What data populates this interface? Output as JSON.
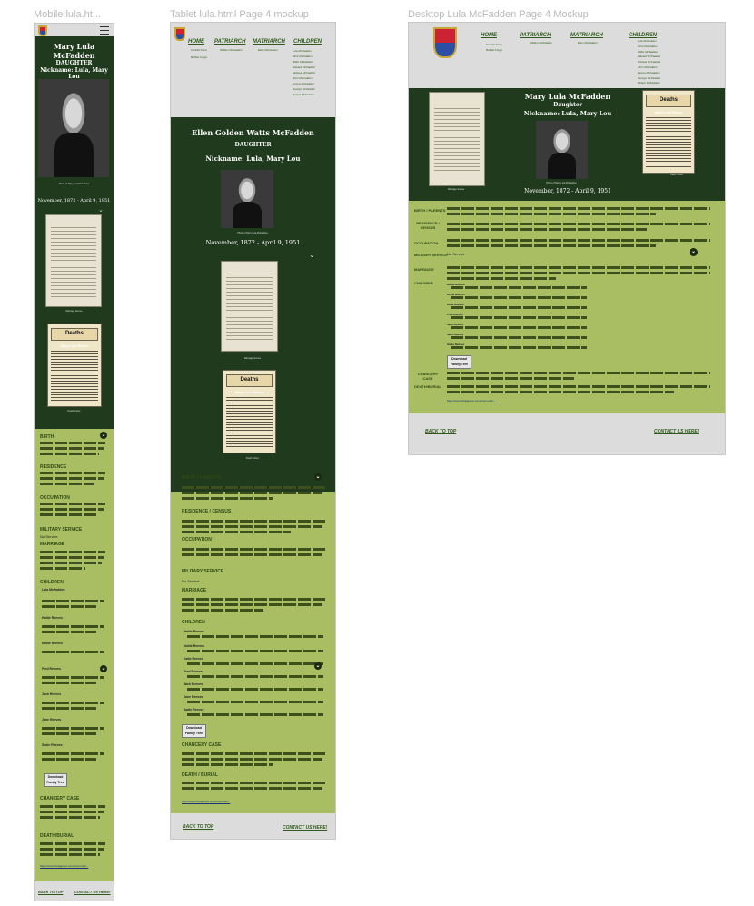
{
  "frames": {
    "mobile_label": "Mobile lula.ht...",
    "tablet_label": "Tablet lula.html Page 4 mockup",
    "desktop_label": "Desktop Lula McFadden Page 4 Mockup"
  },
  "nav": {
    "home": "HOME",
    "patriarch": "PATRIARCH",
    "matriarch": "MATRIARCH",
    "children": "CHILDREN",
    "home_subs": [
      "Contact Form",
      "Buffalo Forge"
    ],
    "patriarch_sub": "William McFadden",
    "matriarch_sub": "Ellen McFadden",
    "children_list": [
      "Lula McFadden",
      "Alice McFadden",
      "Willie McFadden",
      "Edward McFadden",
      "Melissa McFadden",
      "John McFadden",
      "Emma McFadden",
      "George McFadden",
      "Robert McFadden"
    ]
  },
  "person": {
    "name_mobile": "Mary Lula McFadden",
    "name_tablet": "Ellen Golden Watts McFadden",
    "role": "DAUGHTER",
    "role_desktop": "Daughter",
    "nickname": "Nickname: Lula, Mary Lou",
    "dates": "November, 1872 - April 9, 1951",
    "photo_caption": "Photo of Mary Lula McFadden",
    "doc_caption": "Marriage license",
    "clip_caption": "Death notice",
    "deaths": "Deaths",
    "clip_name": "Mary Lou Reese"
  },
  "sections": {
    "birth": "BIRTH",
    "birth_parents": "BIRTH / PARENTS",
    "residence": "RESIDENCE",
    "residence_census": "RESIDENCE / CENSUS",
    "occupation": "OCCUPATION",
    "military": "MILITARY SERVICE",
    "military_value": "No Service",
    "marriage": "MARRIAGE",
    "children": "CHILDREN",
    "chancery": "CHANCERY CASE",
    "death_burial": "DEATH/BURIAL",
    "death_burial_t": "DEATH / BURIAL",
    "lorem": "Lorem ipsum dolor sit amet consectetur adipiscing elit. Nunc vulputate libero et velit interdum, ac aliquet odio mattis."
  },
  "children_items": [
    "Lula McFadden",
    "Hattie Reeves",
    "Noble Reeves",
    "Katie Reeves",
    "Fred Reeves",
    "Jack Reeves",
    "Jane Reeves",
    "Sadie Reeves"
  ],
  "buttons": {
    "download": "Download Family Tree"
  },
  "link_url": "https://www.findagrave.com/memorial/...",
  "footer": {
    "back": "BACK TO TOP",
    "contact": "CONTACT US HERE!"
  },
  "colors": {
    "dark_green": "#1f3a1c",
    "light_green": "#a9bd63",
    "grey": "#dcdcdc",
    "link": "#2e5b19"
  }
}
